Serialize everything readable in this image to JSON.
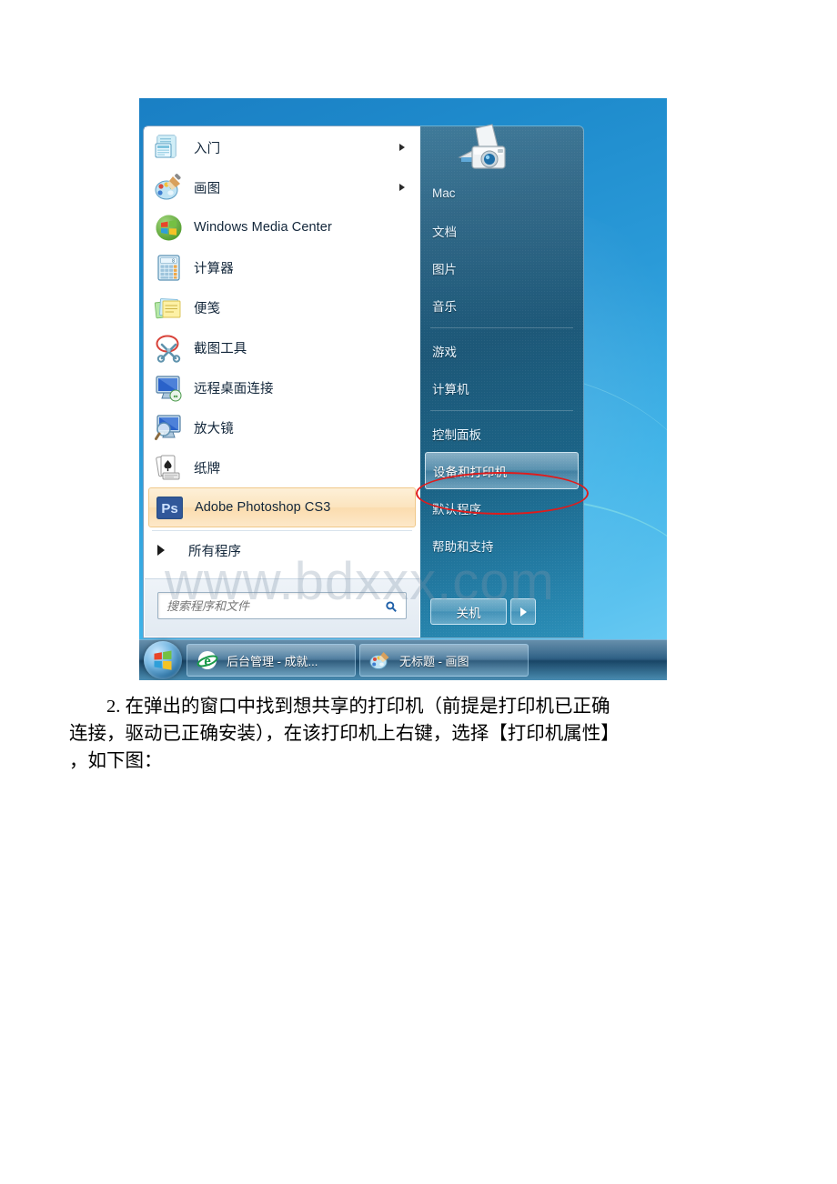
{
  "document": {
    "paragraph_lines": [
      "2. 在弹出的窗口中找到想共享的打印机（前提是打印机已正确",
      "连接，驱动已正确安装），在该打印机上右键，选择【打印机属性】",
      "，如下图："
    ]
  },
  "screenshot": {
    "watermark": "www.bdxxx.com",
    "start_menu": {
      "left_pane": {
        "items": [
          {
            "label": "入门",
            "icon": "getting-started-icon",
            "has_submenu": true,
            "highlighted": false
          },
          {
            "label": "画图",
            "icon": "paint-palette-icon",
            "has_submenu": true,
            "highlighted": false
          },
          {
            "label": "Windows Media Center",
            "icon": "windows-media-center-icon",
            "has_submenu": false,
            "highlighted": false
          },
          {
            "label": "计算器",
            "icon": "calculator-icon",
            "has_submenu": false,
            "highlighted": false
          },
          {
            "label": "便笺",
            "icon": "sticky-notes-icon",
            "has_submenu": false,
            "highlighted": false
          },
          {
            "label": "截图工具",
            "icon": "snipping-tool-icon",
            "has_submenu": false,
            "highlighted": false
          },
          {
            "label": "远程桌面连接",
            "icon": "remote-desktop-icon",
            "has_submenu": false,
            "highlighted": false
          },
          {
            "label": "放大镜",
            "icon": "magnifier-icon",
            "has_submenu": false,
            "highlighted": false
          },
          {
            "label": "纸牌",
            "icon": "solitaire-cards-icon",
            "has_submenu": false,
            "highlighted": false
          },
          {
            "label": "Adobe Photoshop CS3",
            "icon": "photoshop-icon",
            "has_submenu": false,
            "highlighted": true
          }
        ],
        "all_programs_label": "所有程序",
        "search_placeholder": "搜索程序和文件",
        "search_value": ""
      },
      "right_pane": {
        "avatar_icon": "camera-scanner-avatar-icon",
        "items": [
          {
            "label": "Mac",
            "selected": false,
            "separator_after": false
          },
          {
            "label": "文档",
            "selected": false,
            "separator_after": false
          },
          {
            "label": "图片",
            "selected": false,
            "separator_after": false
          },
          {
            "label": "音乐",
            "selected": false,
            "separator_after": true
          },
          {
            "label": "游戏",
            "selected": false,
            "separator_after": false
          },
          {
            "label": "计算机",
            "selected": false,
            "separator_after": true
          },
          {
            "label": "控制面板",
            "selected": false,
            "separator_after": false
          },
          {
            "label": "设备和打印机",
            "selected": true,
            "separator_after": false
          },
          {
            "label": "默认程序",
            "selected": false,
            "separator_after": false
          },
          {
            "label": "帮助和支持",
            "selected": false,
            "separator_after": false
          }
        ],
        "shutdown_label": "关机",
        "annotation": {
          "shape": "red-ellipse",
          "target": "设备和打印机",
          "color": "#e01b1b"
        }
      }
    },
    "taskbar": {
      "start_orb_name": "windows-start-orb",
      "buttons": [
        {
          "label": "后台管理 - 成就...",
          "icon": "internet-explorer-icon"
        },
        {
          "label": "无标题 - 画图",
          "icon": "paint-palette-icon"
        }
      ]
    }
  },
  "colors": {
    "accent_blue": "#2a6b8e",
    "highlight_orange": "#fbdcae",
    "annotation_red": "#e01b1b",
    "taskbar_blue": "#265a80"
  }
}
